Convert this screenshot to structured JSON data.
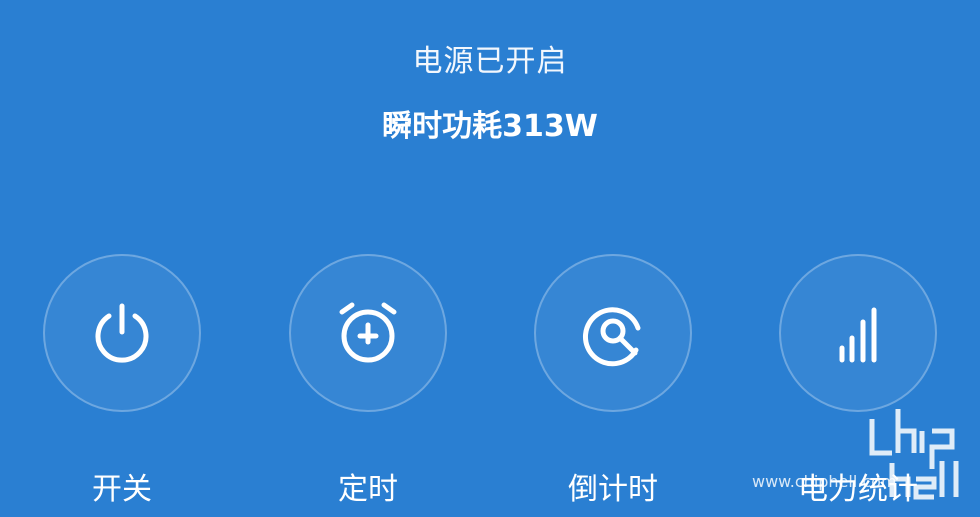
{
  "status": {
    "power_state": "电源已开启",
    "instant_power": "瞬时功耗313W"
  },
  "controls": [
    {
      "label": "开关",
      "icon": "power-icon"
    },
    {
      "label": "定时",
      "icon": "alarm-clock-icon"
    },
    {
      "label": "倒计时",
      "icon": "countdown-icon"
    },
    {
      "label": "电力统计",
      "icon": "bar-chart-icon"
    }
  ],
  "watermark": {
    "url": "www.chiphell.com"
  },
  "colors": {
    "background": "#2a7fd2",
    "foreground": "#ffffff"
  }
}
